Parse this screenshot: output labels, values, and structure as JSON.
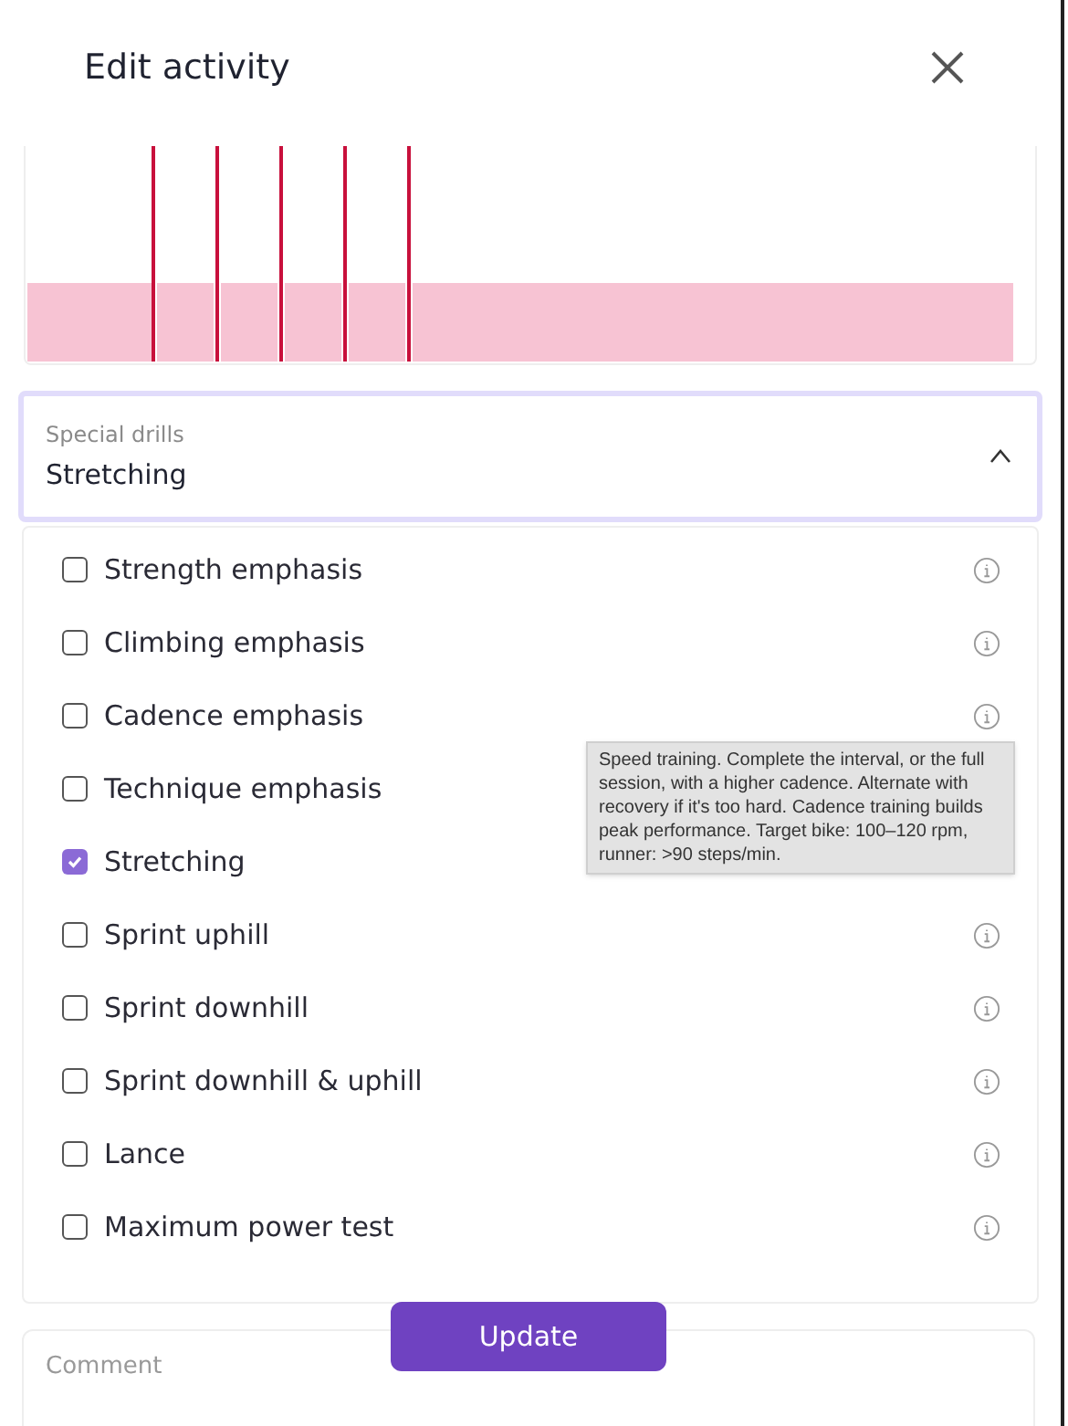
{
  "dialog": {
    "title": "Edit activity"
  },
  "special_drills": {
    "label": "Special drills",
    "value": "Stretching",
    "expanded": true
  },
  "options": [
    {
      "label": "Strength emphasis",
      "checked": false,
      "info": true
    },
    {
      "label": "Climbing emphasis",
      "checked": false,
      "info": true
    },
    {
      "label": "Cadence emphasis",
      "checked": false,
      "info": true
    },
    {
      "label": "Technique emphasis",
      "checked": false,
      "info": false
    },
    {
      "label": "Stretching",
      "checked": true,
      "info": false
    },
    {
      "label": "Sprint uphill",
      "checked": false,
      "info": true
    },
    {
      "label": "Sprint downhill",
      "checked": false,
      "info": true
    },
    {
      "label": "Sprint downhill & uphill",
      "checked": false,
      "info": true
    },
    {
      "label": "Lance",
      "checked": false,
      "info": true
    },
    {
      "label": "Maximum power test",
      "checked": false,
      "info": true
    }
  ],
  "tooltip": "Speed training. Complete the interval, or the full session, with a higher cadence. Alternate with recovery if it's too hard. Cadence training builds peak performance. Target bike: 100–120 rpm, runner: >90 steps/min.",
  "update_button": "Update",
  "comment": {
    "placeholder": "Comment"
  }
}
